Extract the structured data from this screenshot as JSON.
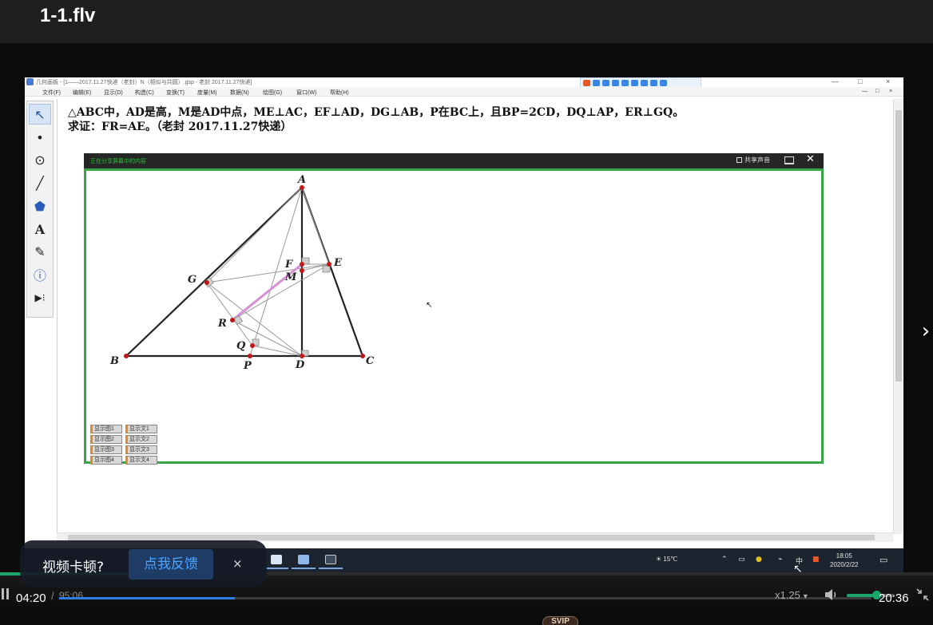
{
  "player": {
    "file_title": "1-1.flv",
    "time_current": "04:20",
    "time_separator": "/",
    "time_total": "95:06",
    "time_end": "20:36",
    "speed": "x1.25",
    "progress_fraction": 0.216,
    "buffered_fraction": 0.0,
    "volume_fraction": 0.62,
    "accent_color": "#1aa56d",
    "progress_color": "#2b7fe0",
    "icons": {
      "pause": "pause-icon",
      "volume": "volume-icon",
      "exit_fullscreen": "exit-fullscreen-icon",
      "next": "chevron-right-icon"
    }
  },
  "feedback": {
    "label": "视频卡顿?",
    "button": "点我反馈",
    "close": "×"
  },
  "badge": "SVIP",
  "gsp": {
    "window_title": "几何画板 - [1——2017.11.27快递（老封）N（相似与共圆）.gsp - 老封 2017.11.27快递]",
    "window_controls": [
      "—",
      "□",
      "×"
    ],
    "menu": [
      "文件(F)",
      "编辑(E)",
      "显示(D)",
      "构造(C)",
      "变换(T)",
      "度量(M)",
      "数据(N)",
      "绘图(G)",
      "窗口(W)",
      "帮助(H)"
    ],
    "menu_controls": [
      "—",
      "□",
      "×"
    ],
    "tools": [
      {
        "name": "selection-arrow-tool",
        "glyph": "↖"
      },
      {
        "name": "point-tool",
        "glyph": "•"
      },
      {
        "name": "compass-tool",
        "glyph": "⊙"
      },
      {
        "name": "straightedge-tool",
        "glyph": "╱"
      },
      {
        "name": "polygon-tool",
        "glyph": "⬟"
      },
      {
        "name": "text-tool",
        "glyph": "A"
      },
      {
        "name": "marker-tool",
        "glyph": "✎"
      },
      {
        "name": "information-tool",
        "glyph": "ⓘ"
      },
      {
        "name": "custom-tool",
        "glyph": "▶⁝"
      }
    ],
    "problem_line1": "△ABC中，AD是高，M是AD中点，ME⊥AC，EF⊥AD，DG⊥AB，P在BC上，且BP=2CD，DQ⊥AP，ER⊥GQ。",
    "problem_line2": "求证：FR=AE。（老封 2017.11.27快递）"
  },
  "share": {
    "header": "正在分享屏幕中的内容",
    "audio": "共享声音",
    "close": "✕"
  },
  "figure": {
    "points": {
      "A": "A",
      "B": "B",
      "C": "C",
      "D": "D",
      "E": "E",
      "F": "F",
      "G": "G",
      "M": "M",
      "P": "P",
      "Q": "Q",
      "R": "R"
    },
    "highlight_color": "#d68fd6",
    "point_color": "#c01818"
  },
  "gsp_buttons": [
    [
      "显示图1",
      "显示文1"
    ],
    [
      "显示图2",
      "显示文2"
    ],
    [
      "显示图3",
      "显示文3"
    ],
    [
      "显示图4",
      "显示文4"
    ]
  ],
  "taskbar": {
    "weather": "15℃",
    "clock_time": "18:05",
    "clock_date": "2020/2/22"
  }
}
